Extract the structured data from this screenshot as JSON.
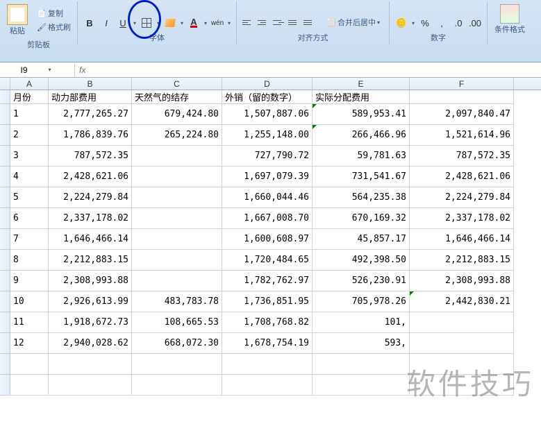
{
  "ribbon": {
    "clipboard": {
      "paste": "粘贴",
      "copy": "复制",
      "format_painter": "格式刷",
      "label": "剪贴板"
    },
    "font": {
      "label": "字体"
    },
    "alignment": {
      "merge_center": "合并后居中",
      "label": "对齐方式"
    },
    "number": {
      "label": "数字"
    },
    "styles": {
      "cond_format": "条件格式"
    }
  },
  "formula_bar": {
    "name_box": "I9",
    "fx": "fx"
  },
  "columns": [
    "A",
    "B",
    "C",
    "D",
    "E",
    "F"
  ],
  "headers": {
    "A": "月份",
    "B": "动力部费用",
    "C": "天然气的结存",
    "D": "外销（留的数字）",
    "E": "实际分配费用",
    "F": ""
  },
  "rows": [
    {
      "A": "1",
      "B": "2,777,265.27",
      "C": "679,424.80",
      "D": "1,507,887.06",
      "E": "589,953.41",
      "F": "2,097,840.47"
    },
    {
      "A": "2",
      "B": "1,786,839.76",
      "C": "265,224.80",
      "D": "1,255,148.00",
      "E": "266,466.96",
      "F": "1,521,614.96"
    },
    {
      "A": "3",
      "B": "787,572.35",
      "C": "",
      "D": "727,790.72",
      "E": "59,781.63",
      "F": "787,572.35"
    },
    {
      "A": "4",
      "B": "2,428,621.06",
      "C": "",
      "D": "1,697,079.39",
      "E": "731,541.67",
      "F": "2,428,621.06"
    },
    {
      "A": "5",
      "B": "2,224,279.84",
      "C": "",
      "D": "1,660,044.46",
      "E": "564,235.38",
      "F": "2,224,279.84"
    },
    {
      "A": "6",
      "B": "2,337,178.02",
      "C": "",
      "D": "1,667,008.70",
      "E": "670,169.32",
      "F": "2,337,178.02"
    },
    {
      "A": "7",
      "B": "1,646,466.14",
      "C": "",
      "D": "1,600,608.97",
      "E": "45,857.17",
      "F": "1,646,466.14"
    },
    {
      "A": "8",
      "B": "2,212,883.15",
      "C": "",
      "D": "1,720,484.65",
      "E": "492,398.50",
      "F": "2,212,883.15"
    },
    {
      "A": "9",
      "B": "2,308,993.88",
      "C": "",
      "D": "1,782,762.97",
      "E": "526,230.91",
      "F": "2,308,993.88"
    },
    {
      "A": "10",
      "B": "2,926,613.99",
      "C": "483,783.78",
      "D": "1,736,851.95",
      "E": "705,978.26",
      "F": "2,442,830.21"
    },
    {
      "A": "11",
      "B": "1,918,672.73",
      "C": "108,665.53",
      "D": "1,708,768.82",
      "E": "101,",
      "F": ""
    },
    {
      "A": "12",
      "B": "2,940,028.62",
      "C": "668,072.30",
      "D": "1,678,754.19",
      "E": "593,",
      "F": ""
    }
  ],
  "watermark": "软件技巧"
}
